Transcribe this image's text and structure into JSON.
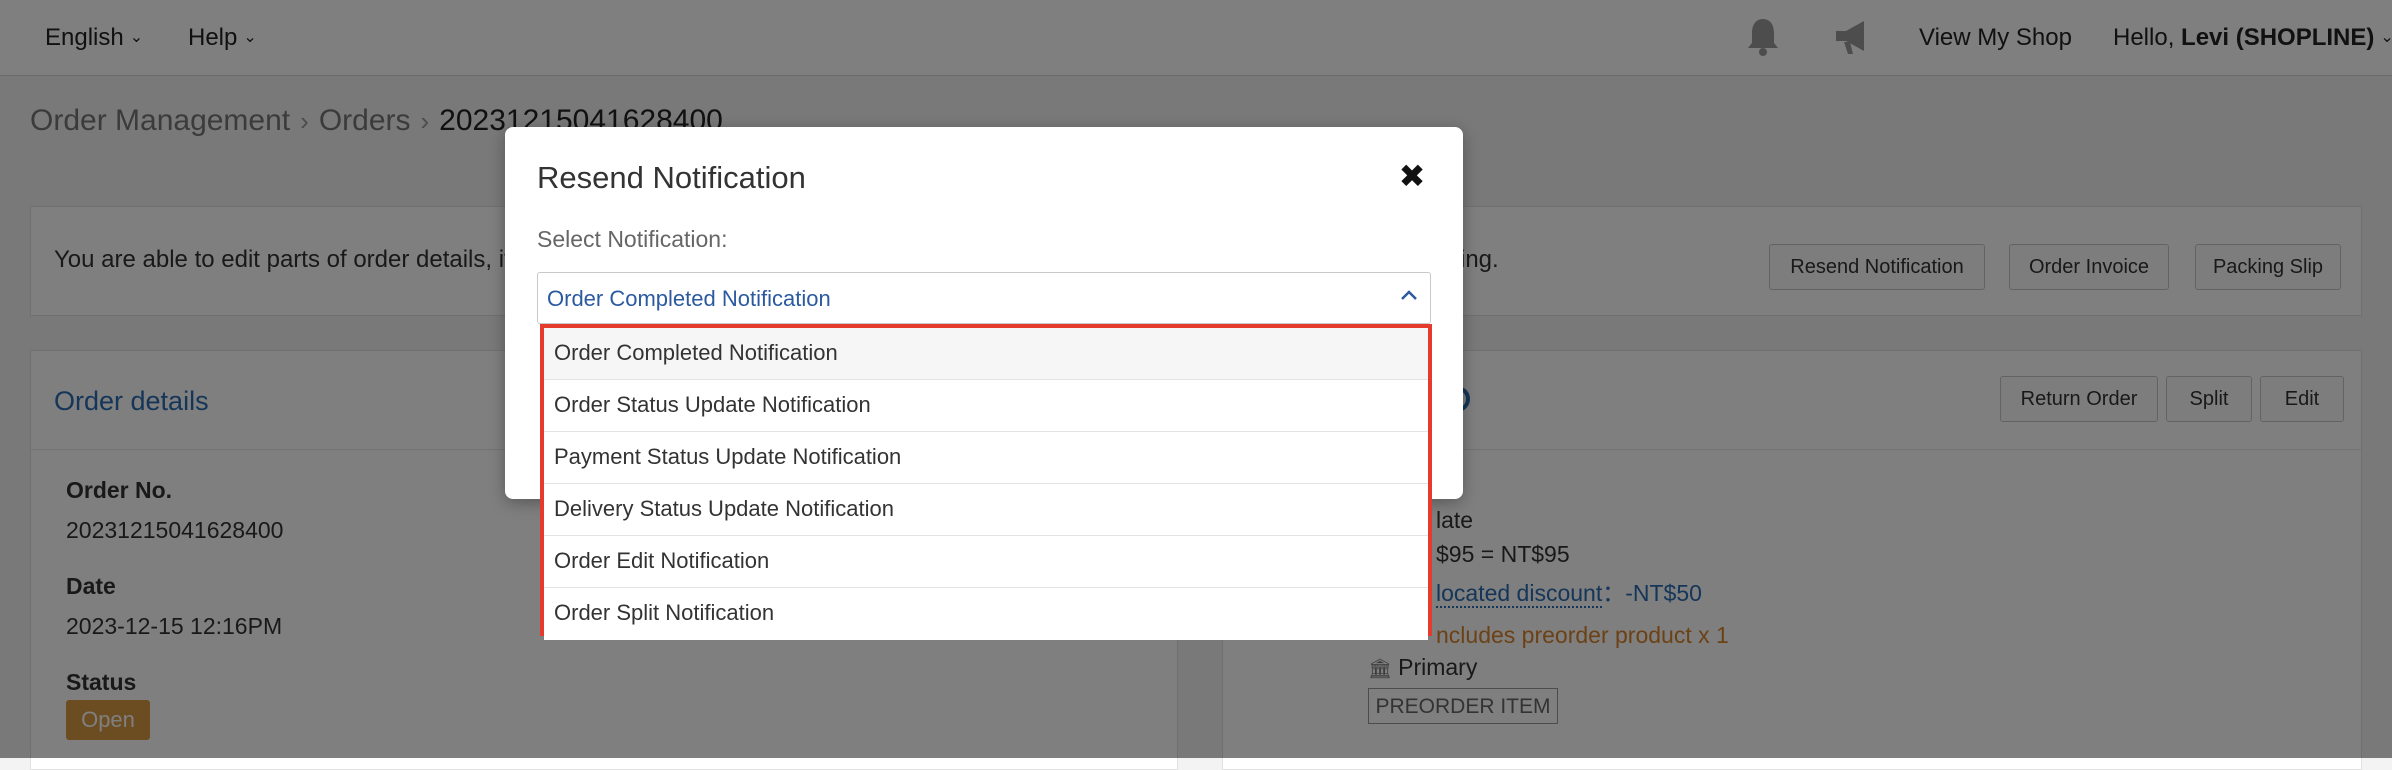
{
  "topbar": {
    "language": "English",
    "help": "Help",
    "view_shop": "View My Shop",
    "hello_prefix": "Hello, ",
    "user": "Levi (SHOPLINE)",
    "icons": [
      "bell-icon",
      "megaphone-icon"
    ]
  },
  "breadcrumb": {
    "items": [
      "Order Management",
      "Orders",
      "20231215041628400"
    ]
  },
  "infobar": {
    "text": "You are able to edit parts of order details, it",
    "text_tail": "iting.",
    "buttons": [
      "Resend Notification",
      "Order Invoice",
      "Packing Slip"
    ]
  },
  "order_details": {
    "title": "Order details",
    "order_no_label": "Order No.",
    "order_no": "20231215041628400",
    "date_label": "Date",
    "date": "2023-12-15 12:16PM",
    "status_label": "Status",
    "status": "Open"
  },
  "right_panel": {
    "buttons": [
      "Return Order",
      "Split",
      "Edit"
    ],
    "line1": "late",
    "price_line": "$95 = NT$95",
    "discount_label": "located discount",
    "discount_value": "：-NT$50",
    "preorder_note": "ncludes preorder product x 1",
    "warehouse": "Primary",
    "preorder_tag": "PREORDER ITEM"
  },
  "modal": {
    "title": "Resend Notification",
    "close": "✖",
    "select_label": "Select Notification:",
    "selected": "Order Completed Notification",
    "options": [
      "Order Completed Notification",
      "Order Status Update Notification",
      "Payment Status Update Notification",
      "Delivery Status Update Notification",
      "Order Edit Notification",
      "Order Split Notification"
    ]
  },
  "colors": {
    "accent_blue": "#2b6cb0",
    "highlight_red": "#e53b2c",
    "status_open": "#d99a43",
    "warning_orange": "#d9822b"
  }
}
